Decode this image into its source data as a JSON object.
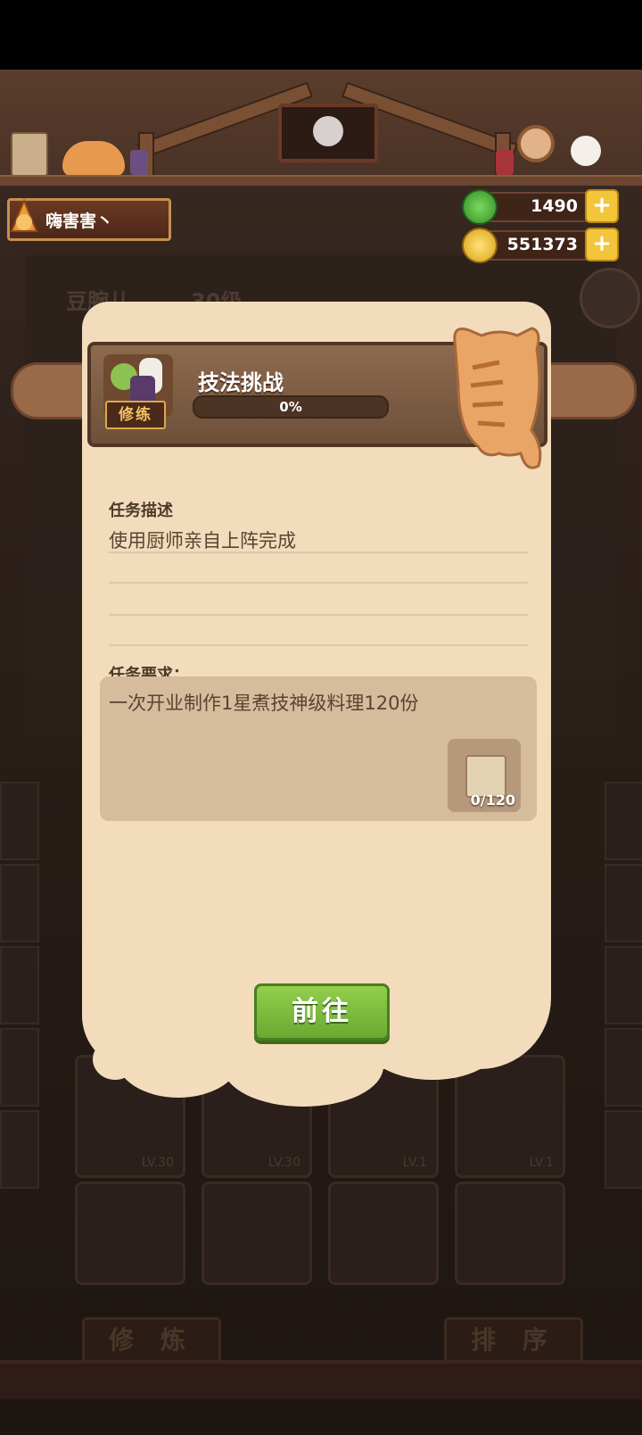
{
  "player": {
    "name": "嗨害害丶"
  },
  "resources": [
    {
      "name": "jade",
      "value": "1490",
      "icon": "jade-coin-icon",
      "color": "#3fae2f"
    },
    {
      "name": "gold",
      "value": "551373",
      "icon": "gold-coin-icon",
      "color": "#f2c234"
    }
  ],
  "background": {
    "chef_name": "豆腕儿",
    "chef_level": "30级",
    "bottom_buttons": [
      "修 炼",
      "排 序"
    ],
    "card_levels": [
      "LV.30",
      "LV.30",
      "LV.1",
      "LV.1"
    ]
  },
  "dialog": {
    "tag": "修练",
    "title": "技法挑战",
    "progress": {
      "label": "0%",
      "value": 0
    },
    "desc_label": "任务描述",
    "desc_text": "使用厨师亲自上阵完成",
    "req_label": "任务要求：",
    "req_text": "一次开业制作1星煮技神级料理120份",
    "req_count": "0/120",
    "go_button": "前往"
  }
}
